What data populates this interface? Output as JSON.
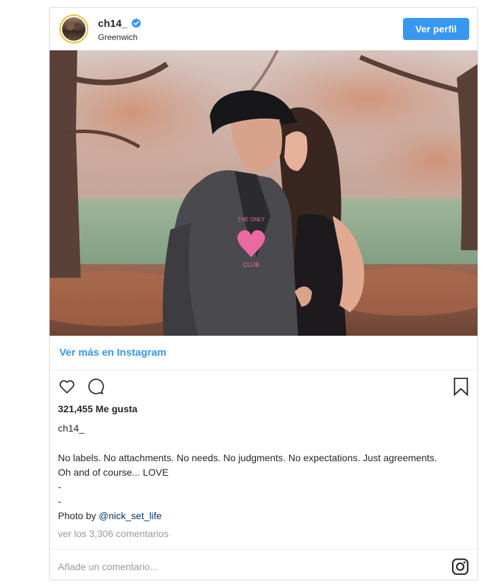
{
  "header": {
    "username": "ch14_",
    "location": "Greenwich",
    "profile_button": "Ver perfil"
  },
  "photo": {
    "shirt_text_top": "THE ONLY",
    "shirt_text_bottom": "CLUB"
  },
  "see_more": "Ver más en Instagram",
  "likes": "321,455 Me gusta",
  "owner": "ch14_",
  "caption": {
    "line1": "No labels. No attachments. No needs. No judgments. No expectations. Just agreements. Oh and of course... LOVE",
    "dash1": "-",
    "dash2": "-",
    "credit_prefix": "Photo by ",
    "mention": "@nick_set_life"
  },
  "comments_link": "ver los 3,306 comentarios",
  "comment_placeholder": "Añade un comentario...",
  "colors": {
    "accent": "#3897f0",
    "verified": "#3897f0",
    "mention": "#003569",
    "muted": "#999999"
  },
  "icons": [
    "verified-badge-icon",
    "heart-icon",
    "comment-bubble-icon",
    "bookmark-icon",
    "instagram-logo-icon"
  ]
}
